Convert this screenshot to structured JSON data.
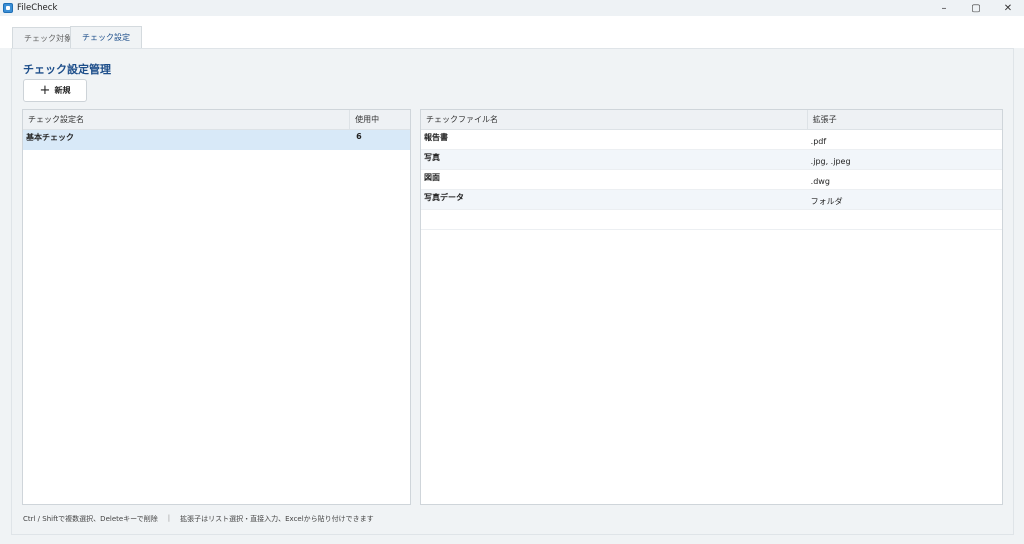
{
  "app": {
    "title": "FileCheck"
  },
  "window_controls": {
    "minimize": "–",
    "restore": "▢",
    "close": "✕"
  },
  "tabs": [
    {
      "label": "チェック対象",
      "active": false
    },
    {
      "label": "チェック設定",
      "active": true
    }
  ],
  "section": {
    "title": "チェック設定管理",
    "new_button": "新規"
  },
  "settings_table": {
    "columns": [
      "チェック設定名",
      "使用中"
    ],
    "rows": [
      {
        "name": "基本チェック",
        "in_use": "6",
        "selected": true
      }
    ]
  },
  "files_table": {
    "columns": [
      "チェックファイル名",
      "拡張子"
    ],
    "rows": [
      {
        "name": "報告書",
        "ext": ".pdf"
      },
      {
        "name": "写真",
        "ext": ".jpg, .jpeg"
      },
      {
        "name": "図面",
        "ext": ".dwg"
      },
      {
        "name": "写真データ",
        "ext": "フォルダ"
      }
    ]
  },
  "footer": {
    "hint1": "Ctrl / Shiftで複数選択、Deleteキーで削除",
    "separator": "|",
    "hint2": "拡張子はリスト選択・直接入力、Excelから貼り付けできます"
  },
  "colors": {
    "accent": "#1d4e8a",
    "selected_row": "#d8e9f8",
    "app_icon": "#3b8fd6"
  }
}
